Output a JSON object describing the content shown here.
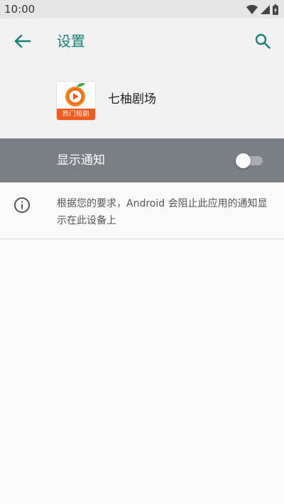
{
  "status_bar": {
    "time": "10:00",
    "icons": [
      "wifi-icon",
      "signal-icon",
      "battery-icon"
    ]
  },
  "toolbar": {
    "back_icon": "arrow-back-icon",
    "title": "设置",
    "search_icon": "search-icon"
  },
  "app": {
    "name": "七柚剧场",
    "icon_band_text": "热门短剧"
  },
  "notification_toggle": {
    "label": "显示通知",
    "enabled": false
  },
  "info": {
    "icon": "info-icon",
    "text": "根据您的要求，Android 会阻止此应用的通知显示在此设备上"
  },
  "colors": {
    "accent": "#167f78",
    "toggle_row_bg": "#7a7f85",
    "icon_orange": "#f05a1e"
  }
}
